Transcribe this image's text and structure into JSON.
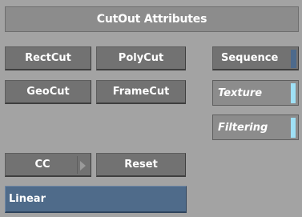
{
  "panel": {
    "title": "CutOut Attributes"
  },
  "buttons": {
    "rectcut": "RectCut",
    "polycut": "PolyCut",
    "geocut": "GeoCut",
    "framecut": "FrameCut",
    "cc": "CC",
    "reset": "Reset"
  },
  "right_controls": {
    "sequence": "Sequence",
    "texture": "Texture",
    "filtering": "Filtering"
  },
  "dropdown": {
    "mode_value": "Linear"
  },
  "colors": {
    "panel_bg": "#a3a3a3",
    "button_bg": "#727272",
    "dropdown_bg": "#4f6b8a",
    "toggle_accent": "#9fe0f5",
    "sequence_stripe": "#4d6a8c"
  },
  "icons": {
    "cc_arrow": "triangle-right-icon"
  }
}
